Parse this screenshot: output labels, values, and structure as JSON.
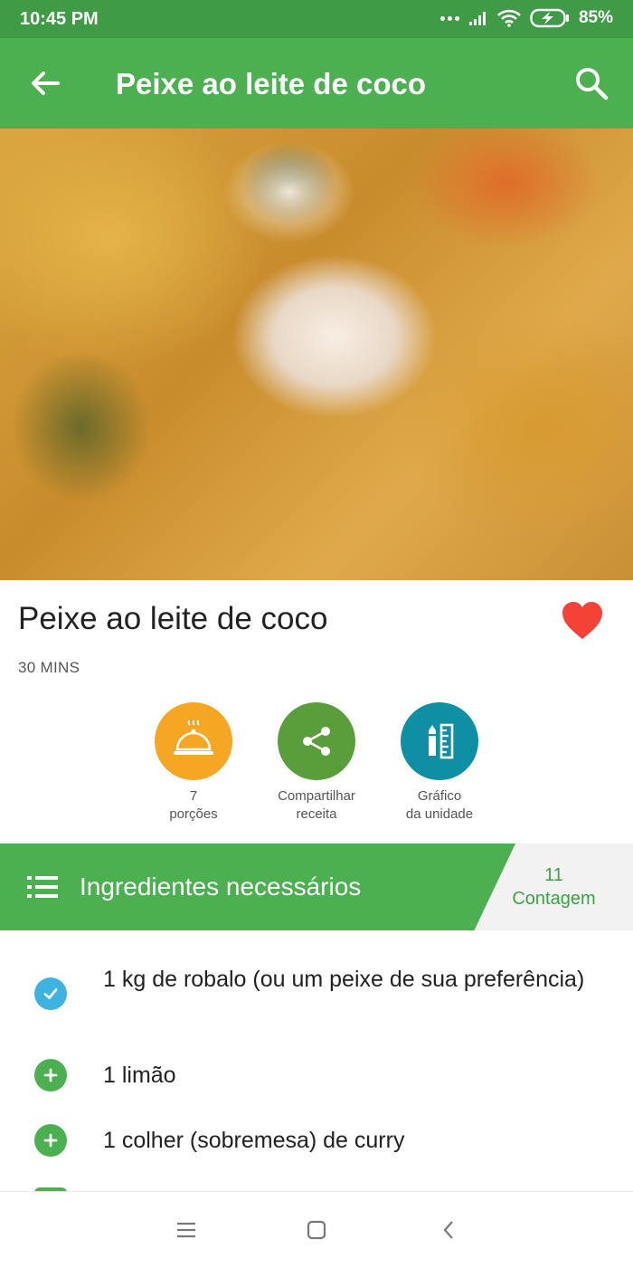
{
  "status_bar": {
    "time": "10:45 PM",
    "battery": "85%"
  },
  "app_bar": {
    "title": "Peixe ao leite de coco",
    "back_icon": "arrow-back-icon",
    "search_icon": "search-icon"
  },
  "hero_image": {
    "description_icon": "food-photo"
  },
  "recipe": {
    "title": "Peixe ao leite de coco",
    "duration": "30 MINS",
    "favorite_color": "#f44336"
  },
  "actions": [
    {
      "line1": "7",
      "line2": "porções",
      "icon": "serving-dish-icon",
      "color": "#f5a623"
    },
    {
      "line1": "Compartilhar",
      "line2": "receita",
      "icon": "share-icon",
      "color": "#5a9e3c"
    },
    {
      "line1": "Gráfico",
      "line2": "da unidade",
      "icon": "ruler-pencil-icon",
      "color": "#0e8fa3"
    }
  ],
  "ingredients": {
    "title": "Ingredientes necessários",
    "count_value": "11",
    "count_label": "Contagem",
    "items": [
      {
        "text": "1 kg de robalo (ou um peixe de sua preferência)",
        "state": "checked"
      },
      {
        "text": "1 limão",
        "state": "add"
      },
      {
        "text": "1 colher (sobremesa) de curry",
        "state": "add"
      }
    ]
  },
  "colors": {
    "status_bar": "#3f9b46",
    "app_bar": "#4caf50",
    "checked_bullet": "#3fb3e0",
    "add_bullet": "#4caf50"
  }
}
